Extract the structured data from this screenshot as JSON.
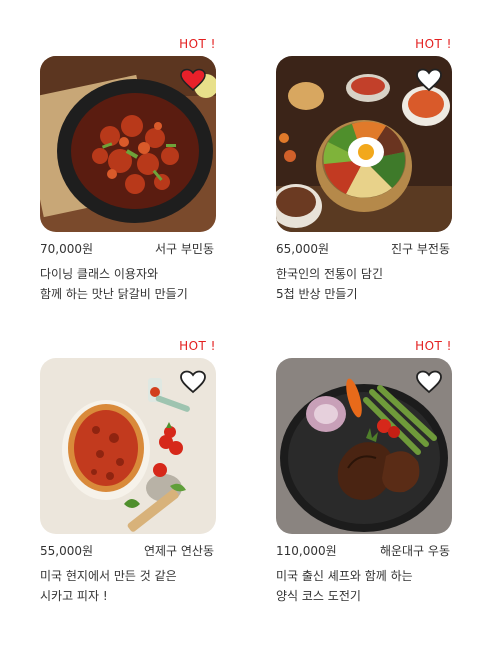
{
  "colors": {
    "hot": "#e32020",
    "heart_active": "#e8202a",
    "heart_outline": "#222222"
  },
  "cards": [
    {
      "badge": "HOT !",
      "price": "70,000원",
      "location": "서구 부민동",
      "title_line1": "다이닝 클래스 이용자와",
      "title_line2": "함께 하는 맛난 닭갈비 만들기",
      "liked": true,
      "image": "spicy-chicken-pan-image"
    },
    {
      "badge": "HOT !",
      "price": "65,000원",
      "location": "진구 부전동",
      "title_line1": "한국인의 전통이 담긴",
      "title_line2": "5첩 반상 만들기",
      "liked": false,
      "image": "bibimbap-image"
    },
    {
      "badge": "HOT !",
      "price": "55,000원",
      "location": "연제구 연산동",
      "title_line1": "미국 현지에서 만든 것 같은",
      "title_line2": "시카고 피자 !",
      "liked": false,
      "image": "chicago-pizza-image"
    },
    {
      "badge": "HOT !",
      "price": "110,000원",
      "location": "해운대구 우동",
      "title_line1": "미국 출신 셰프와 함께 하는",
      "title_line2": "양식 코스 도전기",
      "liked": false,
      "image": "steak-plate-image"
    }
  ]
}
